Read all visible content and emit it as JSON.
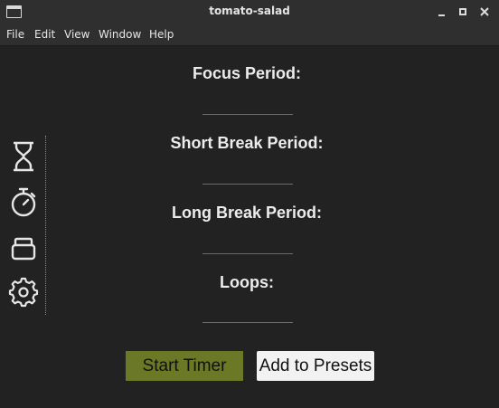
{
  "window": {
    "title": "tomato-salad"
  },
  "menu": {
    "items": [
      "File",
      "Edit",
      "View",
      "Window",
      "Help"
    ]
  },
  "sidebar": {
    "icons": [
      "hourglass-icon",
      "stopwatch-icon",
      "presets-stack-icon",
      "gear-icon"
    ]
  },
  "form": {
    "focus_label": "Focus Period:",
    "focus_value": "",
    "short_break_label": "Short Break Period:",
    "short_break_value": "",
    "long_break_label": "Long Break Period:",
    "long_break_value": "",
    "loops_label": "Loops:",
    "loops_value": ""
  },
  "actions": {
    "start_label": "Start Timer",
    "presets_label": "Add to Presets"
  },
  "colors": {
    "background": "#222222",
    "start_button": "#6b7826",
    "presets_button": "#f2f2f2",
    "titlebar": "#2f2f2f"
  }
}
